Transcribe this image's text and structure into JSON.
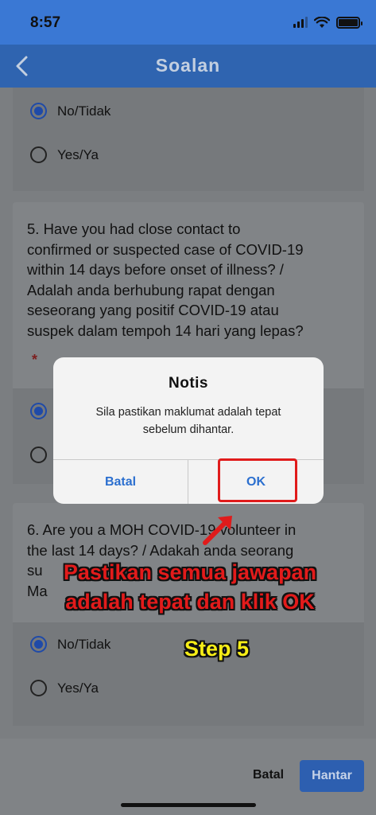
{
  "status_bar": {
    "time": "8:57"
  },
  "header": {
    "title": "Soalan"
  },
  "q4": {
    "options": [
      {
        "label": "No/Tidak",
        "selected": true
      },
      {
        "label": "Yes/Ya",
        "selected": false
      }
    ]
  },
  "q5": {
    "text_lines": [
      "5.  Have you had close contact to",
      "confirmed or suspected case of COVID-19",
      "within 14 days before onset of illness? /",
      "Adalah anda berhubung rapat dengan",
      "seseorang yang positif COVID-19 atau",
      "suspek dalam tempoh 14 hari yang lepas?"
    ],
    "required_mark": "*"
  },
  "q6": {
    "text_lines": [
      "6.  Are you a MOH COVID-19 volunteer in",
      "the last 14 days? / Adakah anda seorang",
      "su",
      "Ma"
    ],
    "options": [
      {
        "label": "No/Tidak",
        "selected": true
      },
      {
        "label": "Yes/Ya",
        "selected": false
      }
    ]
  },
  "footer": {
    "cancel_label": "Batal",
    "submit_label": "Hantar"
  },
  "dialog": {
    "title": "Notis",
    "message_line1": "Sila pastikan maklumat adalah tepat",
    "message_line2": "sebelum dihantar.",
    "cancel_label": "Batal",
    "ok_label": "OK"
  },
  "annotation": {
    "instruction_line1": "Pastikan semua jawapan",
    "instruction_line2": "adalah tepat dan klik OK",
    "step_label": "Step 5"
  },
  "colors": {
    "accent": "#2f64b0",
    "highlight": "#e01b1b",
    "step_text": "#f7ee17"
  }
}
